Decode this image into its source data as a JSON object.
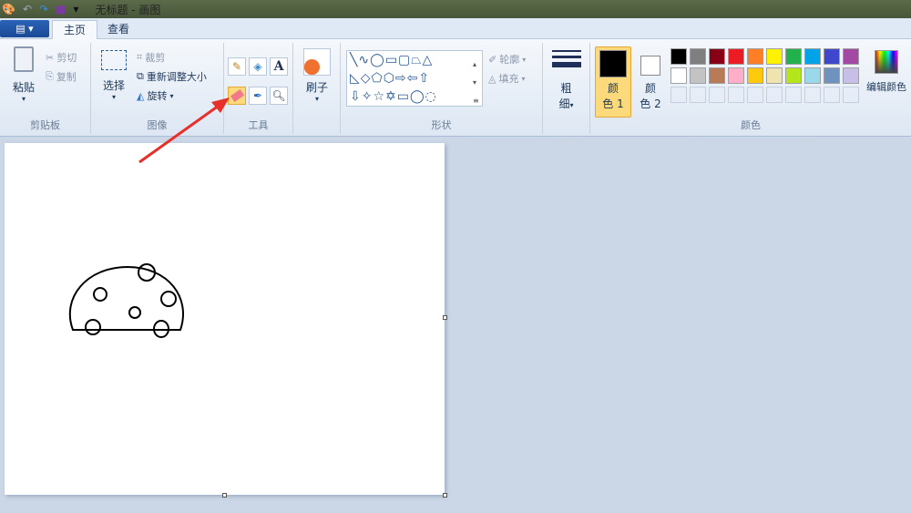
{
  "titlebar": {
    "title": "无标题 - 画图"
  },
  "tabs": {
    "file": "▤ ▾",
    "home": "主页",
    "view": "查看"
  },
  "clipboard": {
    "paste": "粘贴",
    "cut": "剪切",
    "copy": "复制",
    "label": "剪贴板"
  },
  "image": {
    "select": "选择",
    "crop": "裁剪",
    "resize": "重新调整大小",
    "rotate": "旋转",
    "label": "图像"
  },
  "tools": {
    "label": "工具",
    "text_glyph": "A",
    "selected": "eraser"
  },
  "brushes": {
    "label": "刷子"
  },
  "shapes": {
    "label": "形状",
    "outline": "轮廓",
    "fill": "填充"
  },
  "size": {
    "label1": "粗",
    "label2": "细"
  },
  "colors": {
    "color1_a": "颜",
    "color1_b": "色 1",
    "color2_a": "颜",
    "color2_b": "色 2",
    "edit": "编辑颜色",
    "label": "颜色",
    "color1": "#000000",
    "color2": "#ffffff",
    "palette_row1": [
      "#000000",
      "#7f7f7f",
      "#880015",
      "#ed1c24",
      "#ff7f27",
      "#fff200",
      "#22b14c",
      "#00a2e8",
      "#3f48cc",
      "#a349a4"
    ],
    "palette_row2": [
      "#ffffff",
      "#c3c3c3",
      "#b97a57",
      "#ffaec9",
      "#ffc90e",
      "#efe4b0",
      "#b5e61d",
      "#99d9ea",
      "#7092be",
      "#c8bfe7"
    ]
  },
  "annotation": {
    "arrow_color": "#e8302a"
  }
}
